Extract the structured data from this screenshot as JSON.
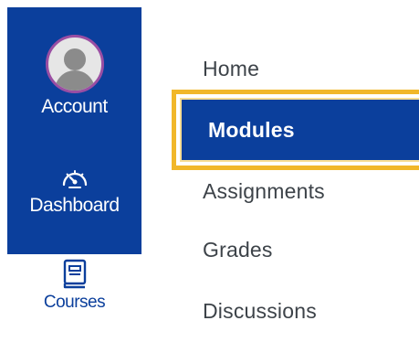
{
  "global_nav": {
    "items": [
      {
        "label": "Account",
        "icon": "avatar"
      },
      {
        "label": "Dashboard",
        "icon": "speedometer-icon"
      },
      {
        "label": "Courses",
        "icon": "book-icon"
      }
    ]
  },
  "course_nav": {
    "items": [
      {
        "label": "Home"
      },
      {
        "label": "Modules"
      },
      {
        "label": "Assignments"
      },
      {
        "label": "Grades"
      },
      {
        "label": "Discussions"
      }
    ],
    "selected": "Modules"
  },
  "colors": {
    "nav_blue": "#0b3f9c",
    "highlight_gold": "#f1b72a",
    "text_gray": "#3d4349",
    "avatar_ring": "#9a4ea3"
  }
}
